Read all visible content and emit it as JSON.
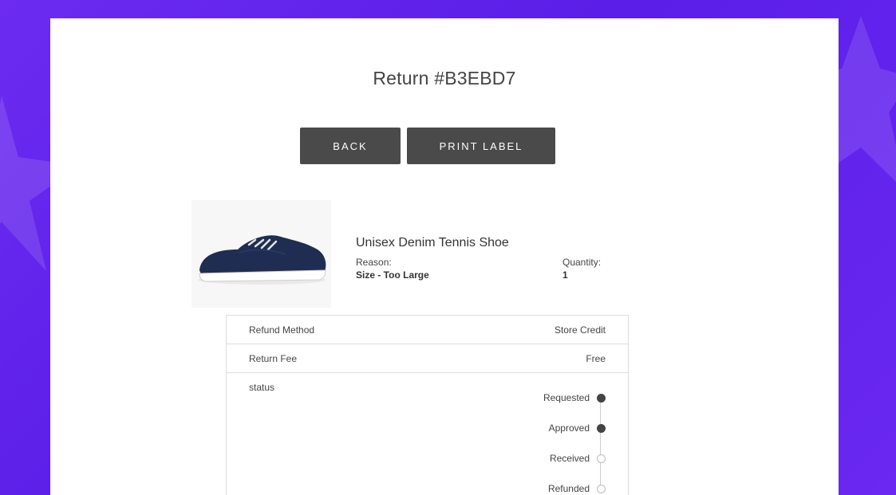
{
  "page": {
    "title": "Return #B3EBD7"
  },
  "actions": {
    "back_label": "BACK",
    "print_label": "PRINT LABEL"
  },
  "product": {
    "name": "Unisex Denim Tennis Shoe",
    "reason_label": "Reason:",
    "reason_value": "Size - Too Large",
    "quantity_label": "Quantity:",
    "quantity_value": "1",
    "image_icon": "denim-shoe"
  },
  "details": {
    "refund_method_label": "Refund Method",
    "refund_method_value": "Store Credit",
    "return_fee_label": "Return Fee",
    "return_fee_value": "Free",
    "status_label": "status"
  },
  "status_steps": [
    {
      "label": "Requested",
      "done": true
    },
    {
      "label": "Approved",
      "done": true
    },
    {
      "label": "Received",
      "done": false
    },
    {
      "label": "Refunded",
      "done": false
    }
  ],
  "colors": {
    "background": "#5a1ee8",
    "button": "#4a4a4a",
    "done_dot": "#444444"
  }
}
